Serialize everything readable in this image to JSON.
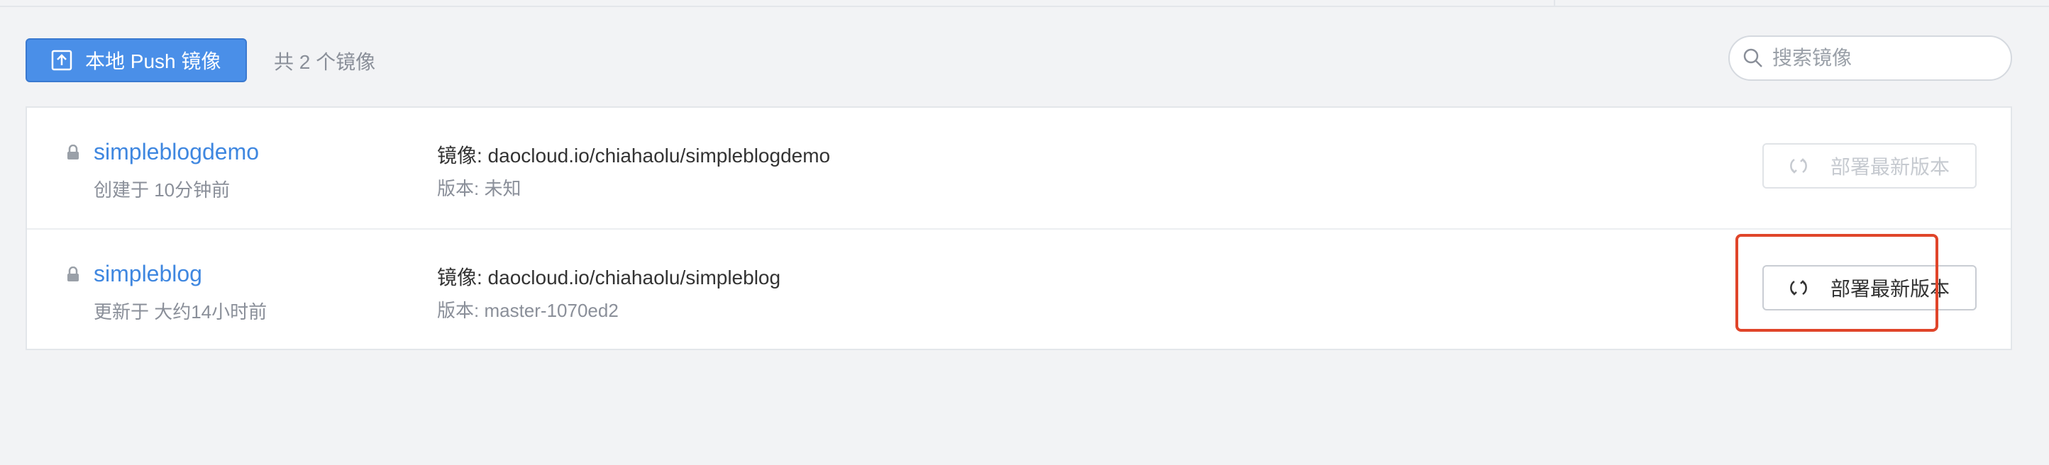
{
  "toolbar": {
    "push_button_label": "本地 Push 镜像",
    "image_count_text": "共 2 个镜像",
    "search_placeholder": "搜索镜像"
  },
  "repos": [
    {
      "name": "simpleblogdemo",
      "time": "创建于 10分钟前",
      "image": "镜像: daocloud.io/chiahaolu/simpleblogdemo",
      "version": "版本: 未知",
      "deploy_label": "部署最新版本",
      "deploy_enabled": false
    },
    {
      "name": "simpleblog",
      "time": "更新于 大约14小时前",
      "image": "镜像: daocloud.io/chiahaolu/simpleblog",
      "version": "版本: master-1070ed2",
      "deploy_label": "部署最新版本",
      "deploy_enabled": true
    }
  ],
  "colors": {
    "primary": "#4a8fe8",
    "link": "#3f87e0",
    "highlight": "#e0452a",
    "background": "#f2f3f5"
  },
  "icons": {
    "push_button_icon": "upload-icon",
    "search_icon": "search-icon",
    "lock_icon": "lock-icon",
    "deploy_icon": "refresh-icon"
  }
}
